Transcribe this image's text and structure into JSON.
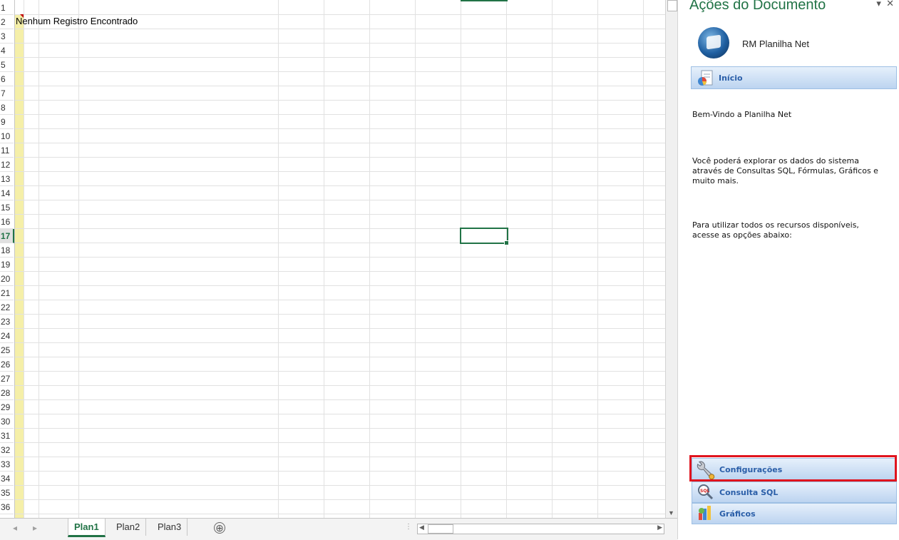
{
  "spreadsheet": {
    "row_numbers": [
      "1",
      "2",
      "3",
      "4",
      "5",
      "6",
      "7",
      "8",
      "9",
      "10",
      "11",
      "12",
      "13",
      "14",
      "15",
      "16",
      "17",
      "18",
      "19",
      "20",
      "21",
      "22",
      "23",
      "24",
      "25",
      "26",
      "27",
      "28",
      "29",
      "30",
      "31",
      "32",
      "33",
      "34",
      "35",
      "36"
    ],
    "active_row": "17",
    "cell_b2_text": "Nenhum Registro Encontrado"
  },
  "sheets": {
    "tabs": [
      {
        "label": "Plan1",
        "active": true
      },
      {
        "label": "Plan2",
        "active": false
      },
      {
        "label": "Plan3",
        "active": false
      }
    ],
    "add_symbol": "⊕"
  },
  "pane": {
    "title": "Ações do Documento",
    "dropdown_icon": "▾",
    "close_icon": "✕",
    "app_name": "RM Planilha Net",
    "inicio_label": "Início",
    "welcome": "Bem-Vindo a Planilha Net",
    "description": "Você poderá explorar os dados do sistema através de Consultas SQL, Fórmulas, Gráficos e muito mais.",
    "instructions": "Para utilizar todos os recursos disponíveis, acesse as opções abaixo:",
    "buttons": {
      "config": "Configurações",
      "sql": "Consulta SQL",
      "graficos": "Gráficos"
    }
  },
  "colors": {
    "excel_green": "#217346",
    "highlight_red": "#e0141e",
    "panel_blue": "#2a5ea8"
  }
}
